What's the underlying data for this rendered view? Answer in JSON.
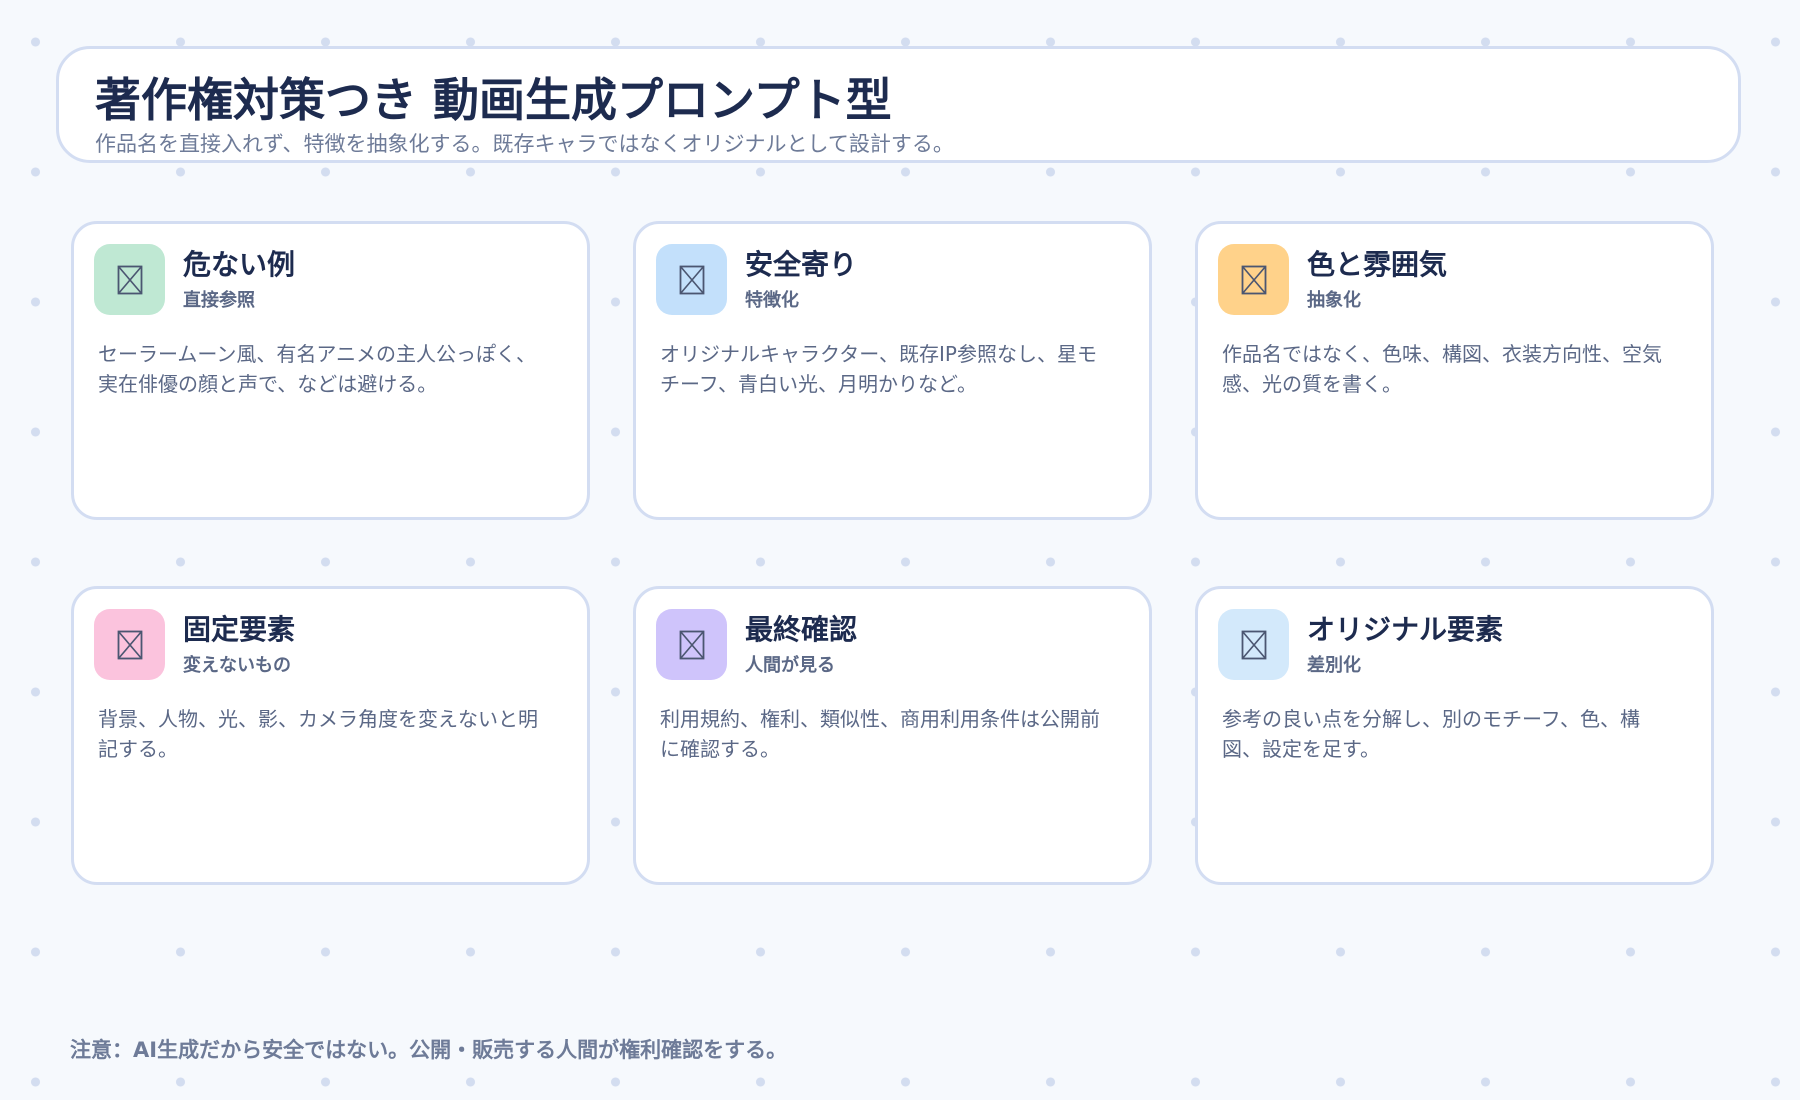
{
  "header": {
    "title": "著作権対策つき 動画生成プロンプト型",
    "subtitle": "作品名を直接入れず、特徴を抽象化する。既存キャラではなくオリジナルとして設計する。"
  },
  "cards": [
    {
      "title": "危ない例",
      "subtitle": "直接参照",
      "description": "セーラームーン風、有名アニメの主人公っぽく、実在俳優の顔と声で、などは避ける。",
      "icon": "broken-image-icon",
      "icon_bg": "#bfe8d3"
    },
    {
      "title": "安全寄り",
      "subtitle": "特徴化",
      "description": "オリジナルキャラクター、既存IP参照なし、星モチーフ、青白い光、月明かりなど。",
      "icon": "broken-image-icon",
      "icon_bg": "#c3e0fb"
    },
    {
      "title": "色と雰囲気",
      "subtitle": "抽象化",
      "description": "作品名ではなく、色味、構図、衣装方向性、空気感、光の質を書く。",
      "icon": "broken-image-icon",
      "icon_bg": "#ffd28a"
    },
    {
      "title": "固定要素",
      "subtitle": "変えないもの",
      "description": "背景、人物、光、影、カメラ角度を変えないと明記する。",
      "icon": "broken-image-icon",
      "icon_bg": "#fbc3dd"
    },
    {
      "title": "最終確認",
      "subtitle": "人間が見る",
      "description": "利用規約、権利、類似性、商用利用条件は公開前に確認する。",
      "icon": "broken-image-icon",
      "icon_bg": "#cfc4fb"
    },
    {
      "title": "オリジナル要素",
      "subtitle": "差別化",
      "description": "参考の良い点を分解し、別のモチーフ、色、構図、設定を足す。",
      "icon": "broken-image-icon",
      "icon_bg": "#d3e9fb"
    }
  ],
  "footer": {
    "note": "注意：AI生成だから安全ではない。公開・販売する人間が権利確認をする。"
  },
  "colors": {
    "background": "#f6f9fd",
    "border": "#d3ddf2",
    "title_text": "#1d2b4f",
    "muted_text": "#6e7b98"
  }
}
